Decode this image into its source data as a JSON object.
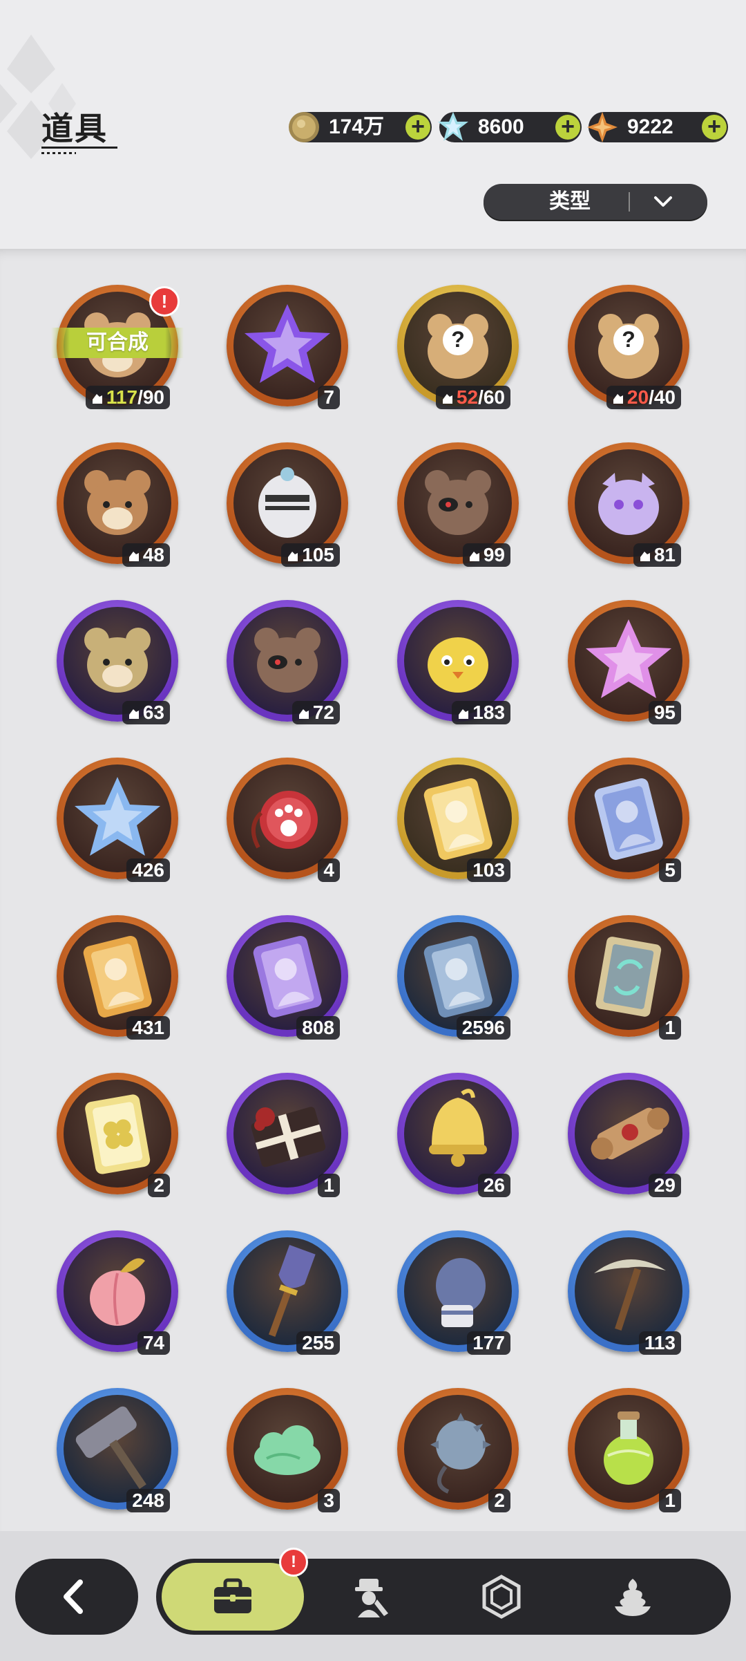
{
  "header": {
    "title": "道具",
    "currencies": [
      {
        "icon": "gold-coin-icon",
        "value": "174万"
      },
      {
        "icon": "crystal-icon",
        "value": "8600"
      },
      {
        "icon": "star-gem-icon",
        "value": "9222"
      }
    ],
    "filter_label": "类型"
  },
  "items": [
    {
      "icon": "teddy-bear-shard-icon",
      "rarity": "orange",
      "kind": "shard",
      "count": "117",
      "total": "/90",
      "alert": "!",
      "ready": "可合成",
      "count_color": "hi"
    },
    {
      "icon": "purple-crystal-clock-icon",
      "rarity": "orange",
      "kind": "plain",
      "count": "7"
    },
    {
      "icon": "mystery-bear-icon",
      "rarity": "gold",
      "kind": "shard",
      "count": "52",
      "total": "/60",
      "count_color": "lo"
    },
    {
      "icon": "mystery-bear-icon",
      "rarity": "orange",
      "kind": "shard",
      "count": "20",
      "total": "/40",
      "count_color": "lo"
    },
    {
      "icon": "brown-bear-icon",
      "rarity": "orange",
      "kind": "shard",
      "count": "48"
    },
    {
      "icon": "knight-helmet-icon",
      "rarity": "orange",
      "kind": "shard",
      "count": "105"
    },
    {
      "icon": "eyepatch-bear-icon",
      "rarity": "orange",
      "kind": "shard",
      "count": "99"
    },
    {
      "icon": "lavender-creature-icon",
      "rarity": "orange",
      "kind": "shard",
      "count": "81"
    },
    {
      "icon": "green-bow-bear-icon",
      "rarity": "purple",
      "kind": "shard",
      "count": "63"
    },
    {
      "icon": "eyepatch-bear-icon",
      "rarity": "purple",
      "kind": "shard",
      "count": "72"
    },
    {
      "icon": "yellow-chick-icon",
      "rarity": "purple",
      "kind": "shard",
      "count": "183"
    },
    {
      "icon": "pink-star-crystal-icon",
      "rarity": "orange",
      "kind": "plain",
      "count": "95"
    },
    {
      "icon": "blue-star-crystal-icon",
      "rarity": "orange",
      "kind": "plain",
      "count": "426"
    },
    {
      "icon": "paw-pocket-watch-icon",
      "rarity": "orange",
      "kind": "plain",
      "count": "4"
    },
    {
      "icon": "gold-character-card-icon",
      "rarity": "gold",
      "kind": "plain",
      "count": "103"
    },
    {
      "icon": "rainbow-character-card-icon",
      "rarity": "orange",
      "kind": "plain",
      "count": "5"
    },
    {
      "icon": "orange-card-icon",
      "rarity": "orange",
      "kind": "plain",
      "count": "431"
    },
    {
      "icon": "purple-card-icon",
      "rarity": "purple",
      "kind": "plain",
      "count": "808"
    },
    {
      "icon": "blue-card-icon",
      "rarity": "blue",
      "kind": "plain",
      "count": "2596"
    },
    {
      "icon": "swap-card-icon",
      "rarity": "orange",
      "kind": "plain",
      "count": "1"
    },
    {
      "icon": "clover-card-icon",
      "rarity": "orange",
      "kind": "plain",
      "count": "2"
    },
    {
      "icon": "gift-box-icon",
      "rarity": "purple",
      "kind": "plain",
      "count": "1"
    },
    {
      "icon": "golden-bell-icon",
      "rarity": "purple",
      "kind": "plain",
      "count": "26"
    },
    {
      "icon": "scroll-icon",
      "rarity": "purple",
      "kind": "plain",
      "count": "29"
    },
    {
      "icon": "peach-icon",
      "rarity": "purple",
      "kind": "plain",
      "count": "74"
    },
    {
      "icon": "shovel-icon",
      "rarity": "blue",
      "kind": "plain",
      "count": "255"
    },
    {
      "icon": "boxing-glove-icon",
      "rarity": "blue",
      "kind": "plain",
      "count": "177"
    },
    {
      "icon": "pickaxe-icon",
      "rarity": "blue",
      "kind": "plain",
      "count": "113"
    },
    {
      "icon": "hammer-icon",
      "rarity": "blue",
      "kind": "plain",
      "count": "248"
    },
    {
      "icon": "green-cloud-icon",
      "rarity": "orange",
      "kind": "plain",
      "count": "3"
    },
    {
      "icon": "spiked-ball-icon",
      "rarity": "orange",
      "kind": "plain",
      "count": "2"
    },
    {
      "icon": "potion-bottle-icon",
      "rarity": "orange",
      "kind": "plain",
      "count": "1"
    }
  ],
  "nav": {
    "back_icon": "back-arrow-icon",
    "tabs": [
      {
        "icon": "briefcase-icon",
        "active": true,
        "alert": "!"
      },
      {
        "icon": "character-gear-icon"
      },
      {
        "icon": "hexagon-gem-icon"
      },
      {
        "icon": "dessert-icon"
      }
    ]
  },
  "colors": {
    "orange": "#d8742c",
    "purple": "#8a4fd8",
    "gold": "#e6c444",
    "blue": "#4d8fe2",
    "accent": "#bcd33c",
    "alert": "#e83b3b"
  }
}
